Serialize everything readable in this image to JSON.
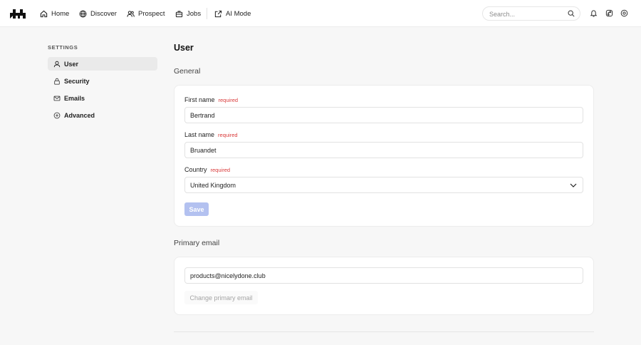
{
  "nav": {
    "items": [
      {
        "label": "Home",
        "icon": "home-icon"
      },
      {
        "label": "Discover",
        "icon": "globe-icon"
      },
      {
        "label": "Prospect",
        "icon": "users-icon"
      },
      {
        "label": "Jobs",
        "icon": "briefcase-icon"
      },
      {
        "label": "AI Mode",
        "icon": "external-link-icon"
      }
    ],
    "search_placeholder": "Search..."
  },
  "sidebar": {
    "heading": "SETTINGS",
    "items": [
      {
        "label": "User",
        "icon": "user-icon",
        "active": true
      },
      {
        "label": "Security",
        "icon": "lock-icon",
        "active": false
      },
      {
        "label": "Emails",
        "icon": "mail-icon",
        "active": false
      },
      {
        "label": "Advanced",
        "icon": "plus-circle-icon",
        "active": false
      }
    ]
  },
  "main": {
    "title": "User",
    "general": {
      "heading": "General",
      "first_name": {
        "label": "First name",
        "required": "required",
        "value": "Bertrand"
      },
      "last_name": {
        "label": "Last name",
        "required": "required",
        "value": "Bruandet"
      },
      "country": {
        "label": "Country",
        "required": "required",
        "value": "United Kingdom"
      },
      "save_label": "Save"
    },
    "primary_email": {
      "heading": "Primary email",
      "value": "products@nicelydone.club",
      "change_label": "Change primary email"
    }
  },
  "colors": {
    "accent_disabled": "#b3c1f0",
    "required": "#d93a3a",
    "background": "#f7f7f7"
  }
}
